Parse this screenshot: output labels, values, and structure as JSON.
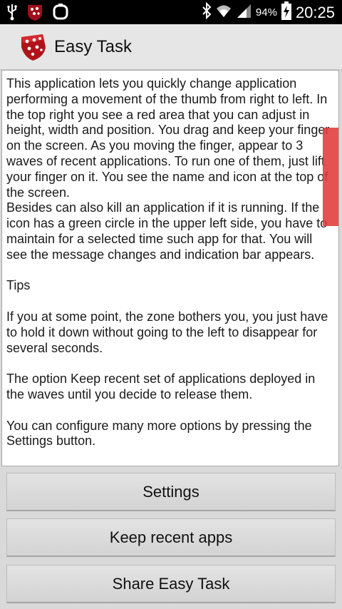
{
  "status_bar": {
    "icons_left": [
      "usb-icon",
      "app-notification-icon",
      "screenshot-icon"
    ],
    "icons_right": [
      "bluetooth-icon",
      "wifi-icon",
      "signal-icon",
      "battery-charging-icon"
    ],
    "battery_percent": "94%",
    "time": "20:25"
  },
  "action_bar": {
    "title": "Easy Task",
    "icon": "easy-task-app-icon"
  },
  "content": {
    "paragraph_1": "This application lets you quickly change application performing a movement of the thumb from right to left. In the top right you see a red area that you can adjust in height, width and position. You drag and keep your finger on the screen. As you moving the finger, appear to 3 waves of recent applications. To run one of them, just lift your finger on it. You see the name and icon at the top of the screen.",
    "paragraph_2": "Besides can also kill an application if it is running. If the icon has a green circle in the upper left side, you have to maintain for a selected time such app for that. You will see the message changes and indication bar appears.",
    "tips_heading": "Tips",
    "paragraph_3": "If you at some point, the zone bothers you, you just have to hold it down without going to the left to disappear for several seconds.",
    "paragraph_4": "The option Keep recent set of applications deployed in the waves until you decide to release them.",
    "paragraph_5": "You can configure many more options by pressing the Settings button."
  },
  "buttons": {
    "settings": "Settings",
    "keep_recent": "Keep recent apps",
    "share": "Share Easy Task"
  },
  "colors": {
    "status_bar_bg": "#000000",
    "action_bar_bg": "#e6e6e6",
    "red_area": "#e03a3a",
    "app_icon_red": "#b0141a"
  }
}
